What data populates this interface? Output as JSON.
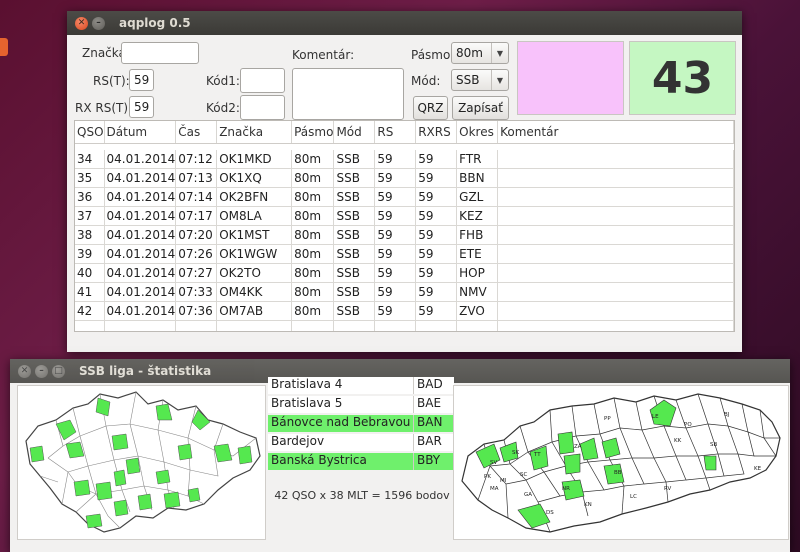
{
  "main_window": {
    "title": "aqplog 0.5",
    "form": {
      "callsign_label": "Značka",
      "callsign_value": "",
      "rst_label": "RS(T):",
      "rst_value": "59",
      "rx_rst_label": "RX RS(T):",
      "rx_rst_value": "59",
      "code1_label": "Kód1:",
      "code1_value": "",
      "code2_label": "Kód2:",
      "code2_value": "",
      "comment_label": "Komentár:",
      "comment_value": "",
      "band_label": "Pásmo:",
      "band_value": "80m",
      "mode_label": "Mód:",
      "mode_value": "SSB",
      "qrz_label": "QRZ",
      "save_label": "Zapísať"
    },
    "counter": "43",
    "table": {
      "headers": [
        "QSO",
        "Dátum",
        "Čas",
        "Značka",
        "Pásmo",
        "Mód",
        "RS",
        "RXRS",
        "Okres",
        "Komentár"
      ],
      "rows": [
        [
          "34",
          "04.01.2014",
          "07:12",
          "OK1MKD",
          "80m",
          "SSB",
          "59",
          "59",
          "FTR",
          ""
        ],
        [
          "35",
          "04.01.2014",
          "07:13",
          "OK1XQ",
          "80m",
          "SSB",
          "59",
          "59",
          "BBN",
          ""
        ],
        [
          "36",
          "04.01.2014",
          "07:14",
          "OK2BFN",
          "80m",
          "SSB",
          "59",
          "59",
          "GZL",
          ""
        ],
        [
          "37",
          "04.01.2014",
          "07:17",
          "OM8LA",
          "80m",
          "SSB",
          "59",
          "59",
          "KEZ",
          ""
        ],
        [
          "38",
          "04.01.2014",
          "07:20",
          "OK1MST",
          "80m",
          "SSB",
          "59",
          "59",
          "FHB",
          ""
        ],
        [
          "39",
          "04.01.2014",
          "07:26",
          "OK1WGW",
          "80m",
          "SSB",
          "59",
          "59",
          "ETE",
          ""
        ],
        [
          "40",
          "04.01.2014",
          "07:27",
          "OK2TO",
          "80m",
          "SSB",
          "59",
          "59",
          "HOP",
          ""
        ],
        [
          "41",
          "04.01.2014",
          "07:33",
          "OM4KK",
          "80m",
          "SSB",
          "59",
          "59",
          "NMV",
          ""
        ],
        [
          "42",
          "04.01.2014",
          "07:36",
          "OM7AB",
          "80m",
          "SSB",
          "59",
          "59",
          "ZVO",
          ""
        ]
      ]
    }
  },
  "stats_window": {
    "title": "SSB liga - štatistika",
    "districts": [
      {
        "name": "Bratislava 4",
        "code": "BAD",
        "worked": false
      },
      {
        "name": "Bratislava 5",
        "code": "BAE",
        "worked": false
      },
      {
        "name": "Bánovce nad Bebravou",
        "code": "BAN",
        "worked": true
      },
      {
        "name": "Bardejov",
        "code": "BAR",
        "worked": false
      },
      {
        "name": "Banská Bystrica",
        "code": "BBY",
        "worked": true
      }
    ],
    "score": "42 QSO x 38 MLT = 1596 bodov",
    "sk_map_labels": [
      "SK",
      "MI",
      "SV",
      "KE",
      "RV",
      "PO",
      "BJ",
      "LE",
      "PP",
      "SB",
      "KK",
      "TT",
      "NR",
      "ZA",
      "BB",
      "LC",
      "KN",
      "DS",
      "SC",
      "MA",
      "PK",
      "GA"
    ]
  },
  "colors": {
    "worked": "#66ee66",
    "pink_box": "#f8c2fb",
    "counter_box": "#c5f7c2"
  }
}
